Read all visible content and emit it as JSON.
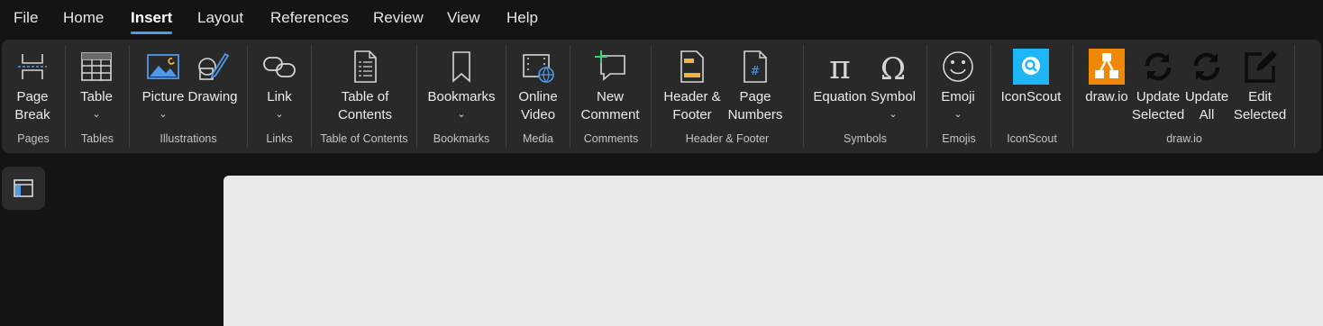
{
  "menu": {
    "tabs": [
      "File",
      "Home",
      "Insert",
      "Layout",
      "References",
      "Review",
      "View",
      "Help"
    ],
    "active_tab": "Insert"
  },
  "ribbon": {
    "groups": {
      "pages": "Pages",
      "tables": "Tables",
      "illustrations": "Illustrations",
      "links": "Links",
      "toc": "Table of Contents",
      "bookmarks": "Bookmarks",
      "media": "Media",
      "comments": "Comments",
      "header_footer": "Header & Footer",
      "symbols": "Symbols",
      "emojis": "Emojis",
      "iconscout": "IconScout",
      "drawio": "draw.io"
    },
    "buttons": {
      "page_break": "Page\nBreak",
      "table": "Table",
      "picture": "Picture",
      "drawing": "Drawing",
      "link": "Link",
      "table_of_contents": "Table of\nContents",
      "bookmarks": "Bookmarks",
      "online_video": "Online\nVideo",
      "new_comment": "New\nComment",
      "header_footer": "Header &\nFooter",
      "page_numbers": "Page\nNumbers",
      "equation": "Equation",
      "symbol": "Symbol",
      "emoji": "Emoji",
      "iconscout": "IconScout",
      "drawio": "draw.io",
      "update_selected": "Update\nSelected",
      "update_all": "Update\nAll",
      "edit_selected": "Edit\nSelected"
    },
    "chevron": "⌄"
  },
  "colors": {
    "accent": "#4f9ae8",
    "ribbon_bg": "#292929",
    "app_bg": "#141414",
    "page_bg": "#e9e9e9",
    "drawio_orange": "#f08705",
    "iconscout_blue": "#1fb6f5"
  }
}
